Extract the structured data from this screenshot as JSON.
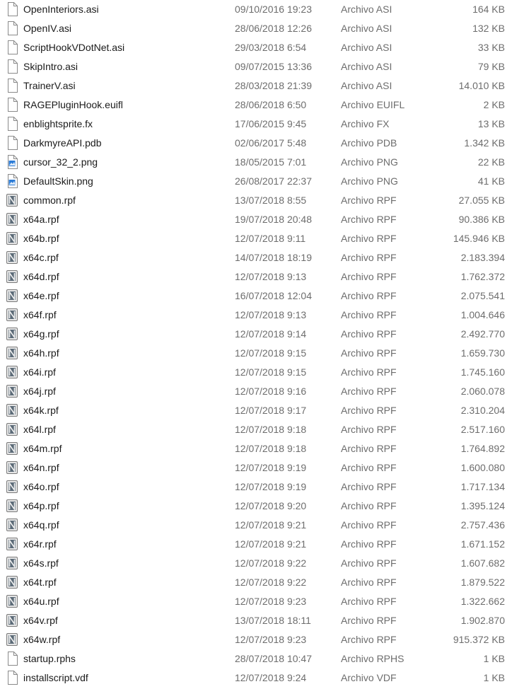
{
  "files": [
    {
      "name": "OpenInteriors.asi",
      "date": "09/10/2016 19:23",
      "type": "Archivo ASI",
      "size": "164 KB",
      "icon": "generic-file-icon"
    },
    {
      "name": "OpenIV.asi",
      "date": "28/06/2018 12:26",
      "type": "Archivo ASI",
      "size": "132 KB",
      "icon": "generic-file-icon"
    },
    {
      "name": "ScriptHookVDotNet.asi",
      "date": "29/03/2018 6:54",
      "type": "Archivo ASI",
      "size": "33 KB",
      "icon": "generic-file-icon"
    },
    {
      "name": "SkipIntro.asi",
      "date": "09/07/2015 13:36",
      "type": "Archivo ASI",
      "size": "79 KB",
      "icon": "generic-file-icon"
    },
    {
      "name": "TrainerV.asi",
      "date": "28/03/2018 21:39",
      "type": "Archivo ASI",
      "size": "14.010 KB",
      "icon": "generic-file-icon"
    },
    {
      "name": "RAGEPluginHook.euifl",
      "date": "28/06/2018 6:50",
      "type": "Archivo EUIFL",
      "size": "2 KB",
      "icon": "generic-file-icon"
    },
    {
      "name": "enblightsprite.fx",
      "date": "17/06/2015 9:45",
      "type": "Archivo FX",
      "size": "13 KB",
      "icon": "generic-file-icon"
    },
    {
      "name": "DarkmyreAPI.pdb",
      "date": "02/06/2017 5:48",
      "type": "Archivo PDB",
      "size": "1.342 KB",
      "icon": "generic-file-icon"
    },
    {
      "name": "cursor_32_2.png",
      "date": "18/05/2015 7:01",
      "type": "Archivo PNG",
      "size": "22 KB",
      "icon": "png-image-icon"
    },
    {
      "name": "DefaultSkin.png",
      "date": "26/08/2017 22:37",
      "type": "Archivo PNG",
      "size": "41 KB",
      "icon": "png-image-icon"
    },
    {
      "name": "common.rpf",
      "date": "13/07/2018 8:55",
      "type": "Archivo RPF",
      "size": "27.055 KB",
      "icon": "rpf-archive-icon"
    },
    {
      "name": "x64a.rpf",
      "date": "19/07/2018 20:48",
      "type": "Archivo RPF",
      "size": "90.386 KB",
      "icon": "rpf-archive-icon"
    },
    {
      "name": "x64b.rpf",
      "date": "12/07/2018 9:11",
      "type": "Archivo RPF",
      "size": "145.946 KB",
      "icon": "rpf-archive-icon"
    },
    {
      "name": "x64c.rpf",
      "date": "14/07/2018 18:19",
      "type": "Archivo RPF",
      "size": "2.183.394",
      "icon": "rpf-archive-icon"
    },
    {
      "name": "x64d.rpf",
      "date": "12/07/2018 9:13",
      "type": "Archivo RPF",
      "size": "1.762.372",
      "icon": "rpf-archive-icon"
    },
    {
      "name": "x64e.rpf",
      "date": "16/07/2018 12:04",
      "type": "Archivo RPF",
      "size": "2.075.541",
      "icon": "rpf-archive-icon"
    },
    {
      "name": "x64f.rpf",
      "date": "12/07/2018 9:13",
      "type": "Archivo RPF",
      "size": "1.004.646",
      "icon": "rpf-archive-icon"
    },
    {
      "name": "x64g.rpf",
      "date": "12/07/2018 9:14",
      "type": "Archivo RPF",
      "size": "2.492.770",
      "icon": "rpf-archive-icon"
    },
    {
      "name": "x64h.rpf",
      "date": "12/07/2018 9:15",
      "type": "Archivo RPF",
      "size": "1.659.730",
      "icon": "rpf-archive-icon"
    },
    {
      "name": "x64i.rpf",
      "date": "12/07/2018 9:15",
      "type": "Archivo RPF",
      "size": "1.745.160",
      "icon": "rpf-archive-icon"
    },
    {
      "name": "x64j.rpf",
      "date": "12/07/2018 9:16",
      "type": "Archivo RPF",
      "size": "2.060.078",
      "icon": "rpf-archive-icon"
    },
    {
      "name": "x64k.rpf",
      "date": "12/07/2018 9:17",
      "type": "Archivo RPF",
      "size": "2.310.204",
      "icon": "rpf-archive-icon"
    },
    {
      "name": "x64l.rpf",
      "date": "12/07/2018 9:18",
      "type": "Archivo RPF",
      "size": "2.517.160",
      "icon": "rpf-archive-icon"
    },
    {
      "name": "x64m.rpf",
      "date": "12/07/2018 9:18",
      "type": "Archivo RPF",
      "size": "1.764.892",
      "icon": "rpf-archive-icon"
    },
    {
      "name": "x64n.rpf",
      "date": "12/07/2018 9:19",
      "type": "Archivo RPF",
      "size": "1.600.080",
      "icon": "rpf-archive-icon"
    },
    {
      "name": "x64o.rpf",
      "date": "12/07/2018 9:19",
      "type": "Archivo RPF",
      "size": "1.717.134",
      "icon": "rpf-archive-icon"
    },
    {
      "name": "x64p.rpf",
      "date": "12/07/2018 9:20",
      "type": "Archivo RPF",
      "size": "1.395.124",
      "icon": "rpf-archive-icon"
    },
    {
      "name": "x64q.rpf",
      "date": "12/07/2018 9:21",
      "type": "Archivo RPF",
      "size": "2.757.436",
      "icon": "rpf-archive-icon"
    },
    {
      "name": "x64r.rpf",
      "date": "12/07/2018 9:21",
      "type": "Archivo RPF",
      "size": "1.671.152",
      "icon": "rpf-archive-icon"
    },
    {
      "name": "x64s.rpf",
      "date": "12/07/2018 9:22",
      "type": "Archivo RPF",
      "size": "1.607.682",
      "icon": "rpf-archive-icon"
    },
    {
      "name": "x64t.rpf",
      "date": "12/07/2018 9:22",
      "type": "Archivo RPF",
      "size": "1.879.522",
      "icon": "rpf-archive-icon"
    },
    {
      "name": "x64u.rpf",
      "date": "12/07/2018 9:23",
      "type": "Archivo RPF",
      "size": "1.322.662",
      "icon": "rpf-archive-icon"
    },
    {
      "name": "x64v.rpf",
      "date": "13/07/2018 18:11",
      "type": "Archivo RPF",
      "size": "1.902.870",
      "icon": "rpf-archive-icon"
    },
    {
      "name": "x64w.rpf",
      "date": "12/07/2018 9:23",
      "type": "Archivo RPF",
      "size": "915.372 KB",
      "icon": "rpf-archive-icon"
    },
    {
      "name": "startup.rphs",
      "date": "28/07/2018 10:47",
      "type": "Archivo RPHS",
      "size": "1 KB",
      "icon": "generic-file-icon"
    },
    {
      "name": "installscript.vdf",
      "date": "12/07/2018 9:24",
      "type": "Archivo VDF",
      "size": "1 KB",
      "icon": "generic-file-icon"
    }
  ],
  "colors": {
    "name_text": "#1a1a1a",
    "detail_text": "#6d6d6d",
    "png_icon_accent": "#2b7bd6",
    "rpf_icon_bg": "#5c6b78"
  }
}
